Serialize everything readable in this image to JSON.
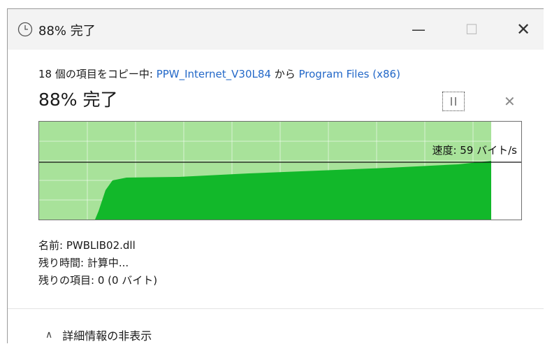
{
  "window": {
    "title": "88% 完了",
    "minimize_label": "—",
    "maximize_label": "☐",
    "close_label": "✕"
  },
  "copy": {
    "prefix": "18 個の項目をコピー中: ",
    "source": "PPW_Internet_V30L84",
    "middle": " から ",
    "destination": "Program Files (x86)",
    "percent_text": "88% 完了",
    "progress_percent": 88,
    "cancel_label": "✕"
  },
  "graph": {
    "speed_text": "速度: 59 バイト/s"
  },
  "info": {
    "name": "名前: PWBLIB02.dll",
    "time_remaining": "残り時間: 計算中...",
    "items_remaining": "残りの項目: 0 (0 バイト)"
  },
  "details": {
    "label": "詳細情報の非表示"
  },
  "colors": {
    "progress_light": "#a8e29a",
    "progress_dark": "#12b82a",
    "link": "#2368c8"
  }
}
